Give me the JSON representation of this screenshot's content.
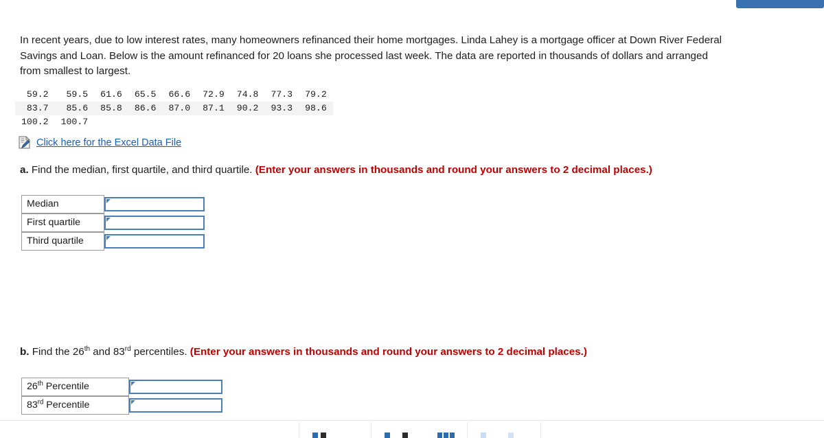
{
  "top_button": {
    "label": ""
  },
  "prompt": {
    "text": "In recent years, due to low interest rates, many homeowners refinanced their home mortgages. Linda Lahey is a mortgage officer at Down River Federal Savings and Loan. Below is the amount refinanced for 20 loans she processed last week. The data are reported in thousands of dollars and arranged from smallest to largest."
  },
  "data_table": {
    "rows": [
      [
        "59.2",
        "59.5",
        "61.6",
        "65.5",
        "66.6",
        "72.9",
        "74.8",
        "77.3",
        "79.2"
      ],
      [
        "83.7",
        "85.6",
        "85.8",
        "86.6",
        "87.0",
        "87.1",
        "90.2",
        "93.3",
        "98.6"
      ],
      [
        "100.2",
        "100.7",
        "",
        "",
        "",
        "",
        "",
        "",
        ""
      ]
    ]
  },
  "excel": {
    "icon": "excel-file-icon",
    "link_text": "Click here for the Excel Data File"
  },
  "question_a": {
    "label": "a.",
    "text": " Find the median, first quartile, and third quartile. ",
    "note": "(Enter your answers in thousands and round your answers to 2 decimal places.)"
  },
  "answers_a": {
    "rows": [
      {
        "label": "Median",
        "value": "",
        "placeholder": ""
      },
      {
        "label": "First quartile",
        "value": "",
        "placeholder": ""
      },
      {
        "label": "Third quartile",
        "value": "",
        "placeholder": ""
      }
    ]
  },
  "question_b": {
    "label": "b.",
    "text_1": " Find the 26",
    "sup_1": "th",
    "text_2": " and 83",
    "sup_2": "rd",
    "text_3": " percentiles. ",
    "note": "(Enter your answers in thousands and round your answers to 2 decimal places.)"
  },
  "answers_b": {
    "rows": [
      {
        "label_num": "26",
        "label_sup": "th",
        "label_rest": " Percentile",
        "value": "",
        "placeholder": ""
      },
      {
        "label_num": "83",
        "label_sup": "rd",
        "label_rest": " Percentile",
        "value": "",
        "placeholder": ""
      }
    ]
  },
  "bottom_bar": {
    "items": [
      {
        "name": "prev-button",
        "label": ""
      },
      {
        "name": "next-button",
        "label": ""
      },
      {
        "name": "grid-button",
        "label": ""
      },
      {
        "name": "help-button",
        "label": ""
      }
    ]
  },
  "colors": {
    "accent_blue": "#3a71b0",
    "input_border": "#4a7ebb",
    "link_blue": "#1a5fb4",
    "note_red": "#c00000",
    "alt_row": "#f3f3f3"
  }
}
